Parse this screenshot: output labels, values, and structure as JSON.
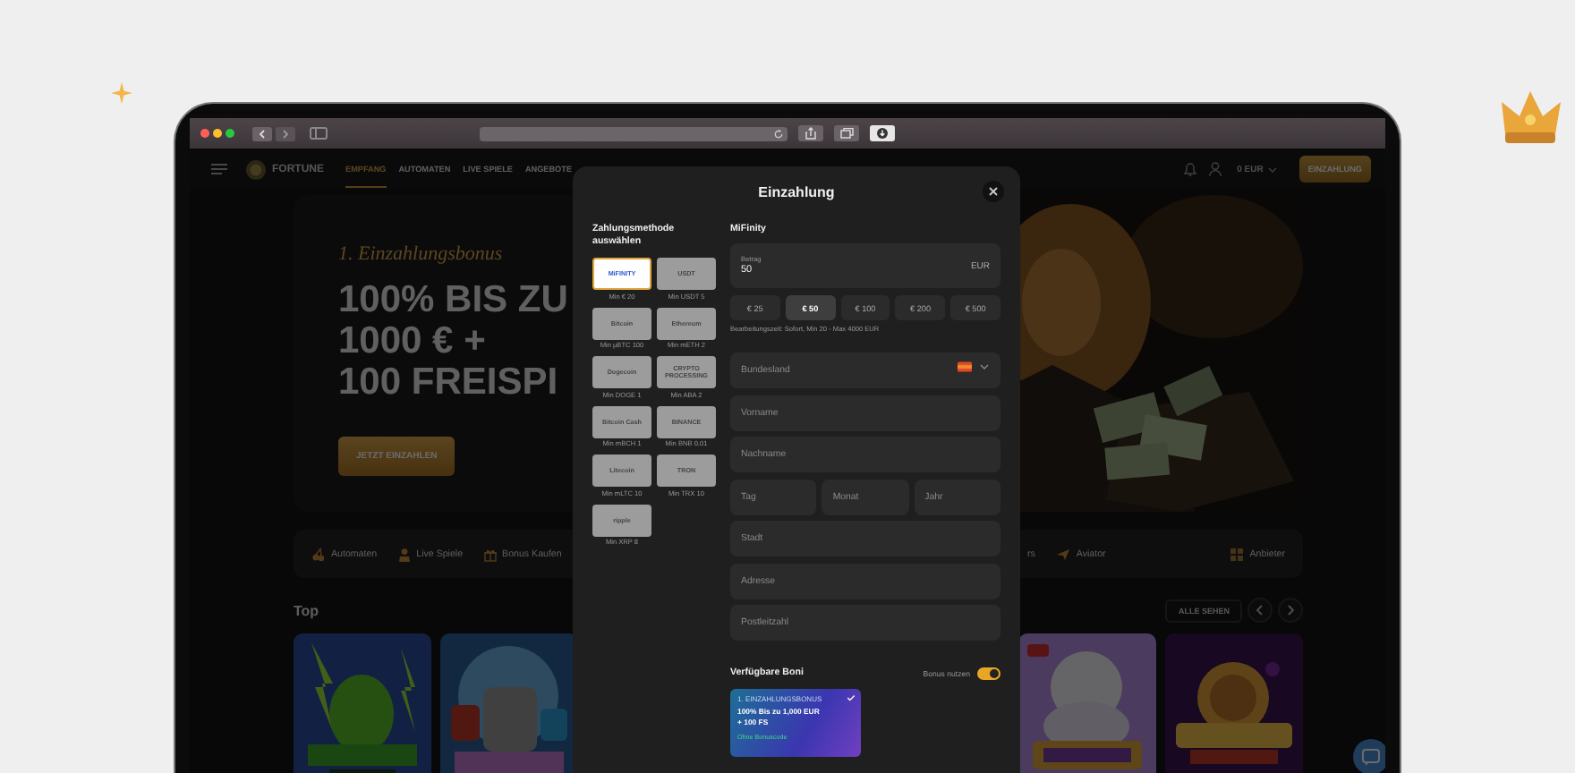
{
  "site": {
    "logo": "FORTUNE",
    "nav": [
      {
        "label": "EMPFANG",
        "selected": true
      },
      {
        "label": "AUTOMATEN",
        "selected": false
      },
      {
        "label": "LIVE SPIELE",
        "selected": false
      },
      {
        "label": "ANGEBOTE",
        "selected": false
      }
    ],
    "balance": "0 EUR",
    "deposit_button": "EINZAHLUNG",
    "hero": {
      "kicker": "1. Einzahlungsbonus",
      "headline": [
        "100% BIS ZU",
        "1000 € +",
        "100 FREISPI"
      ],
      "button": "JETZT EINZAHLEN"
    },
    "categories_left": [
      {
        "kind": "slots",
        "label": "Automaten"
      },
      {
        "kind": "live",
        "label": "Live Spiele"
      },
      {
        "kind": "bonus",
        "label": "Bonus Kaufen"
      }
    ],
    "categories_right": [
      {
        "kind": "text",
        "label": "rs"
      },
      {
        "kind": "aviator",
        "label": "Aviator"
      },
      {
        "kind": "providers",
        "label": "Anbieter"
      }
    ],
    "section": {
      "title": "Top",
      "see_all": "ALLE SEHEN"
    },
    "games_left": [
      {
        "kind": "frog"
      },
      {
        "kind": "robots"
      }
    ],
    "games_right": [
      {
        "kind": "olympus"
      },
      {
        "kind": "coins"
      }
    ]
  },
  "modal": {
    "title": "Einzahlung",
    "methods_title": "Zahlungsmethode auswählen",
    "methods": [
      {
        "logo": "MiFINITY",
        "min": "Min € 20",
        "selected": true
      },
      {
        "logo": "USDT",
        "min": "Min USDT 5",
        "selected": false
      },
      {
        "logo": "Bitcoin",
        "min": "Min µBTC 100",
        "selected": false
      },
      {
        "logo": "Ethereum",
        "min": "Min mETH 2",
        "selected": false
      },
      {
        "logo": "Dogecoin",
        "min": "Min DOGE 1",
        "selected": false
      },
      {
        "logo": "CRYPTO PROCESSING",
        "min": "Min ABA 2",
        "selected": false
      },
      {
        "logo": "Bitcoin Cash",
        "min": "Min mBCH 1",
        "selected": false
      },
      {
        "logo": "BINANCE",
        "min": "Min BNB 0.01",
        "selected": false
      },
      {
        "logo": "Litecoin",
        "min": "Min mLTC 10",
        "selected": false
      },
      {
        "logo": "TRON",
        "min": "Min TRX 10",
        "selected": false
      },
      {
        "logo": "ripple",
        "min": "Min XRP 8",
        "selected": false
      }
    ],
    "method_name": "MiFinity",
    "amount": {
      "label": "Betrag",
      "value": "50",
      "currency": "EUR"
    },
    "presets": [
      {
        "label": "€ 25",
        "selected": false
      },
      {
        "label": "€ 50",
        "selected": true
      },
      {
        "label": "€ 100",
        "selected": false
      },
      {
        "label": "€ 200",
        "selected": false
      },
      {
        "label": "€ 500",
        "selected": false
      }
    ],
    "note": "Bearbeitungszeit: Sofort, Min 20 - Max 4000 EUR",
    "fields": [
      {
        "kind": "select",
        "placeholder": "Bundesland"
      },
      {
        "kind": "text",
        "placeholder": "Vorname"
      },
      {
        "kind": "text",
        "placeholder": "Nachname"
      },
      {
        "kind": "date",
        "parts": [
          {
            "placeholder": "Tag"
          },
          {
            "placeholder": "Monat"
          },
          {
            "placeholder": "Jahr"
          }
        ]
      },
      {
        "kind": "text",
        "placeholder": "Stadt"
      },
      {
        "kind": "text",
        "placeholder": "Adresse"
      },
      {
        "kind": "text",
        "placeholder": "Postleitzahl"
      }
    ],
    "bonus": {
      "title": "Verfügbare Boni",
      "toggle_label": "Bonus nutzen",
      "toggle_on": true,
      "card": {
        "kicker": "1. EINZAHLUNGSBONUS",
        "line1": "100% Bis zu 1,000 EUR",
        "line2": "+ 100 FS",
        "code": "Ohne Bonuscode",
        "checked": true
      }
    }
  }
}
